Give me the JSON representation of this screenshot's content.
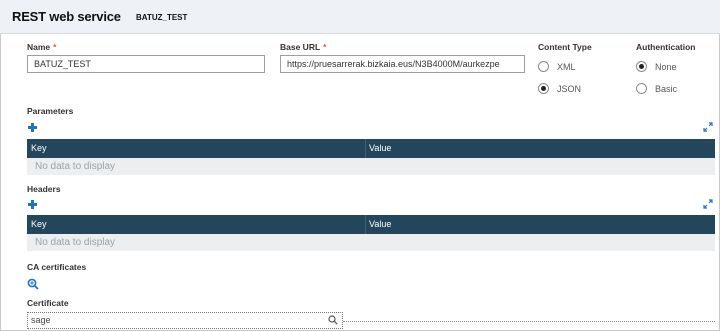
{
  "header": {
    "title": "REST web service",
    "subtitle": "BATUZ_TEST"
  },
  "form": {
    "name": {
      "label": "Name",
      "required_mark": "*",
      "value": "BATUZ_TEST"
    },
    "base_url": {
      "label": "Base URL",
      "required_mark": "*",
      "value": "https://pruesarrerak.bizkaia.eus/N3B4000M/aurkezpe"
    },
    "content_type": {
      "label": "Content Type",
      "options": [
        "XML",
        "JSON"
      ],
      "selected": "JSON"
    },
    "authentication": {
      "label": "Authentication",
      "options": [
        "None",
        "Basic"
      ],
      "selected": "None"
    }
  },
  "parameters": {
    "label": "Parameters",
    "columns": [
      "Key",
      "Value"
    ],
    "empty_text": "No data to display"
  },
  "headers": {
    "label": "Headers",
    "columns": [
      "Key",
      "Value"
    ],
    "empty_text": "No data to display"
  },
  "ca_certificates": {
    "label": "CA certificates"
  },
  "certificate": {
    "label": "Certificate",
    "value": "sage"
  },
  "colors": {
    "grid_header": "#24465d",
    "accent": "#1f72c4",
    "required": "#e05a2b"
  },
  "icons": [
    "add-icon",
    "expand-icon",
    "zoom-icon",
    "search-icon"
  ]
}
